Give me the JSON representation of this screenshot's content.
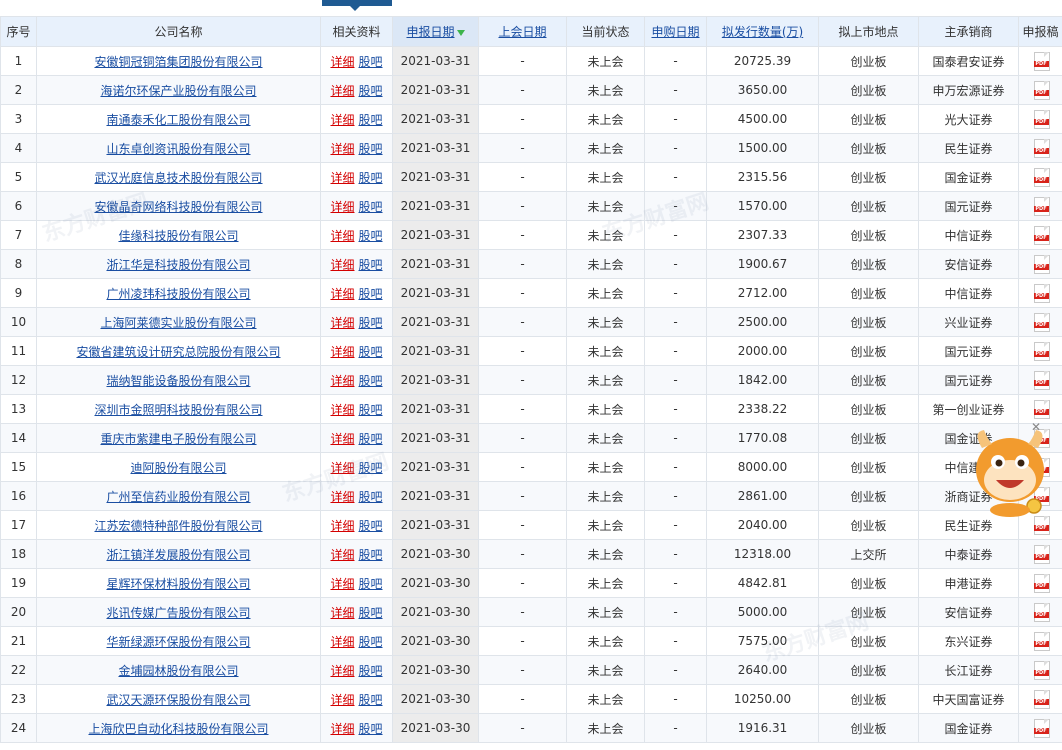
{
  "columns": [
    "序号",
    "公司名称",
    "相关资料",
    "申报日期",
    "上会日期",
    "当前状态",
    "申购日期",
    "拟发行数量(万)",
    "拟上市地点",
    "主承销商",
    "申报稿"
  ],
  "links": {
    "detail": "详细",
    "forum": "股吧"
  },
  "rows": [
    {
      "no": "1",
      "company": "安徽铜冠铜箔集团股份有限公司",
      "date": "2021-03-31",
      "meeting": "-",
      "status": "未上会",
      "sub": "-",
      "qty": "20725.39",
      "market": "创业板",
      "underwriter": "国泰君安证券"
    },
    {
      "no": "2",
      "company": "海诺尔环保产业股份有限公司",
      "date": "2021-03-31",
      "meeting": "-",
      "status": "未上会",
      "sub": "-",
      "qty": "3650.00",
      "market": "创业板",
      "underwriter": "申万宏源证券"
    },
    {
      "no": "3",
      "company": "南通泰禾化工股份有限公司",
      "date": "2021-03-31",
      "meeting": "-",
      "status": "未上会",
      "sub": "-",
      "qty": "4500.00",
      "market": "创业板",
      "underwriter": "光大证券"
    },
    {
      "no": "4",
      "company": "山东卓创资讯股份有限公司",
      "date": "2021-03-31",
      "meeting": "-",
      "status": "未上会",
      "sub": "-",
      "qty": "1500.00",
      "market": "创业板",
      "underwriter": "民生证券"
    },
    {
      "no": "5",
      "company": "武汉光庭信息技术股份有限公司",
      "date": "2021-03-31",
      "meeting": "-",
      "status": "未上会",
      "sub": "-",
      "qty": "2315.56",
      "market": "创业板",
      "underwriter": "国金证券"
    },
    {
      "no": "6",
      "company": "安徽晶奇网络科技股份有限公司",
      "date": "2021-03-31",
      "meeting": "-",
      "status": "未上会",
      "sub": "-",
      "qty": "1570.00",
      "market": "创业板",
      "underwriter": "国元证券"
    },
    {
      "no": "7",
      "company": "佳缘科技股份有限公司",
      "date": "2021-03-31",
      "meeting": "-",
      "status": "未上会",
      "sub": "-",
      "qty": "2307.33",
      "market": "创业板",
      "underwriter": "中信证券"
    },
    {
      "no": "8",
      "company": "浙江华是科技股份有限公司",
      "date": "2021-03-31",
      "meeting": "-",
      "status": "未上会",
      "sub": "-",
      "qty": "1900.67",
      "market": "创业板",
      "underwriter": "安信证券"
    },
    {
      "no": "9",
      "company": "广州凌玮科技股份有限公司",
      "date": "2021-03-31",
      "meeting": "-",
      "status": "未上会",
      "sub": "-",
      "qty": "2712.00",
      "market": "创业板",
      "underwriter": "中信证券"
    },
    {
      "no": "10",
      "company": "上海阿莱德实业股份有限公司",
      "date": "2021-03-31",
      "meeting": "-",
      "status": "未上会",
      "sub": "-",
      "qty": "2500.00",
      "market": "创业板",
      "underwriter": "兴业证券"
    },
    {
      "no": "11",
      "company": "安徽省建筑设计研究总院股份有限公司",
      "date": "2021-03-31",
      "meeting": "-",
      "status": "未上会",
      "sub": "-",
      "qty": "2000.00",
      "market": "创业板",
      "underwriter": "国元证券"
    },
    {
      "no": "12",
      "company": "瑞纳智能设备股份有限公司",
      "date": "2021-03-31",
      "meeting": "-",
      "status": "未上会",
      "sub": "-",
      "qty": "1842.00",
      "market": "创业板",
      "underwriter": "国元证券"
    },
    {
      "no": "13",
      "company": "深圳市金照明科技股份有限公司",
      "date": "2021-03-31",
      "meeting": "-",
      "status": "未上会",
      "sub": "-",
      "qty": "2338.22",
      "market": "创业板",
      "underwriter": "第一创业证券"
    },
    {
      "no": "14",
      "company": "重庆市紫建电子股份有限公司",
      "date": "2021-03-31",
      "meeting": "-",
      "status": "未上会",
      "sub": "-",
      "qty": "1770.08",
      "market": "创业板",
      "underwriter": "国金证券"
    },
    {
      "no": "15",
      "company": "迪阿股份有限公司",
      "date": "2021-03-31",
      "meeting": "-",
      "status": "未上会",
      "sub": "-",
      "qty": "8000.00",
      "market": "创业板",
      "underwriter": "中信建投"
    },
    {
      "no": "16",
      "company": "广州至信药业股份有限公司",
      "date": "2021-03-31",
      "meeting": "-",
      "status": "未上会",
      "sub": "-",
      "qty": "2861.00",
      "market": "创业板",
      "underwriter": "浙商证券"
    },
    {
      "no": "17",
      "company": "江苏宏德特种部件股份有限公司",
      "date": "2021-03-31",
      "meeting": "-",
      "status": "未上会",
      "sub": "-",
      "qty": "2040.00",
      "market": "创业板",
      "underwriter": "民生证券"
    },
    {
      "no": "18",
      "company": "浙江镇洋发展股份有限公司",
      "date": "2021-03-30",
      "meeting": "-",
      "status": "未上会",
      "sub": "-",
      "qty": "12318.00",
      "market": "上交所",
      "underwriter": "中泰证券"
    },
    {
      "no": "19",
      "company": "星辉环保材料股份有限公司",
      "date": "2021-03-30",
      "meeting": "-",
      "status": "未上会",
      "sub": "-",
      "qty": "4842.81",
      "market": "创业板",
      "underwriter": "申港证券"
    },
    {
      "no": "20",
      "company": "兆讯传媒广告股份有限公司",
      "date": "2021-03-30",
      "meeting": "-",
      "status": "未上会",
      "sub": "-",
      "qty": "5000.00",
      "market": "创业板",
      "underwriter": "安信证券"
    },
    {
      "no": "21",
      "company": "华新绿源环保股份有限公司",
      "date": "2021-03-30",
      "meeting": "-",
      "status": "未上会",
      "sub": "-",
      "qty": "7575.00",
      "market": "创业板",
      "underwriter": "东兴证券"
    },
    {
      "no": "22",
      "company": "金埔园林股份有限公司",
      "date": "2021-03-30",
      "meeting": "-",
      "status": "未上会",
      "sub": "-",
      "qty": "2640.00",
      "market": "创业板",
      "underwriter": "长江证券"
    },
    {
      "no": "23",
      "company": "武汉天源环保股份有限公司",
      "date": "2021-03-30",
      "meeting": "-",
      "status": "未上会",
      "sub": "-",
      "qty": "10250.00",
      "market": "创业板",
      "underwriter": "中天国富证券"
    },
    {
      "no": "24",
      "company": "上海欣巴自动化科技股份有限公司",
      "date": "2021-03-30",
      "meeting": "-",
      "status": "未上会",
      "sub": "-",
      "qty": "1916.31",
      "market": "创业板",
      "underwriter": "国金证券"
    }
  ],
  "colors": {
    "header_bg": "#e8f1fc",
    "link_blue": "#1a4ea2",
    "link_red": "#d40000",
    "sort_arrow": "#3cb44b"
  }
}
